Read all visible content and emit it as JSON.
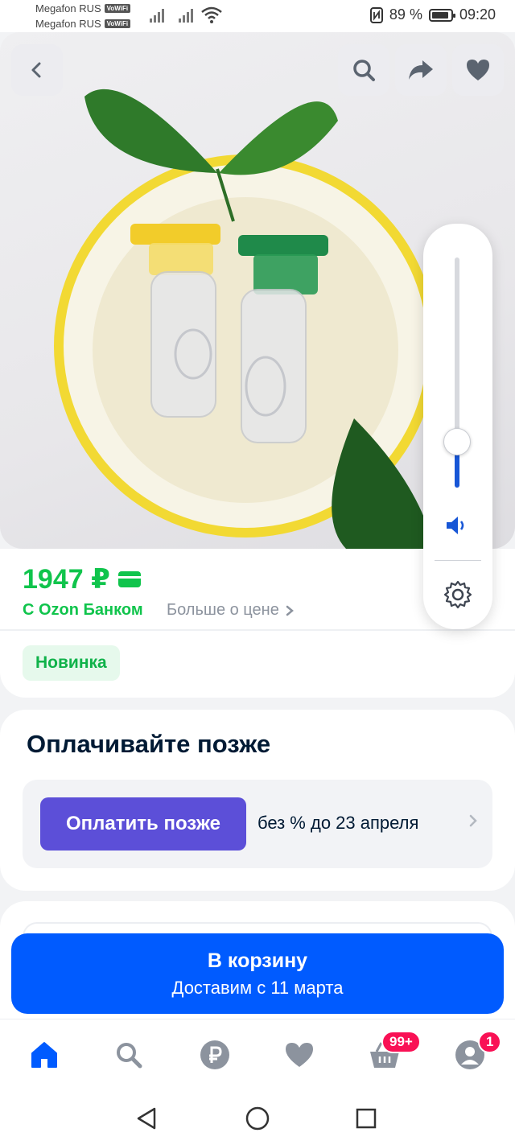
{
  "status_bar": {
    "carrier1": "Megafon RUS",
    "carrier2": "Megafon RUS",
    "vowifi": "VoWiFi",
    "battery": "89 %",
    "time": "09:20"
  },
  "hero": {
    "back_icon": "chevron-left-icon",
    "search_icon": "search-icon",
    "share_icon": "share-icon",
    "favorite_icon": "heart-icon"
  },
  "volume_panel": {
    "level": 0.2,
    "speaker_icon": "speaker-icon",
    "settings_icon": "gear-icon"
  },
  "price": {
    "value": "1947 ₽",
    "bank_label": "С Ozon Банком",
    "more_label": "Больше о цене",
    "badge": "Новинка"
  },
  "paylater": {
    "title": "Оплачивайте позже",
    "button": "Оплатить позже",
    "text": "без % до 23 апреля"
  },
  "cart": {
    "label": "В корзину",
    "delivery": "Доставим с 11 марта"
  },
  "bottom_nav": {
    "cart_badge": "99+",
    "profile_badge": "1"
  },
  "colors": {
    "green": "#10c44c",
    "blue": "#005bff",
    "purple": "#5c4fd8",
    "badge_pink": "#f91155"
  }
}
